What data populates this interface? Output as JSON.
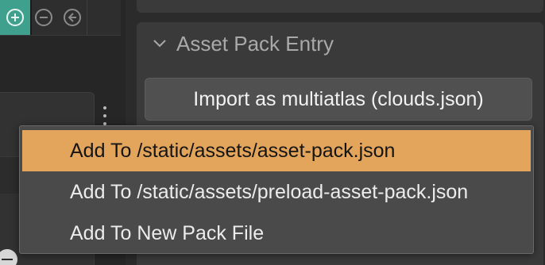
{
  "toolbar": {
    "zoom_in_icon": "zoom-in-icon",
    "zoom_out_icon": "zoom-out-icon",
    "zoom_reset_icon": "zoom-reset-icon",
    "active_color": "#3fa08d"
  },
  "inspector": {
    "section_title": "Asset Pack Entry",
    "import_button_label": "Import as multiatlas (clouds.json)"
  },
  "context_menu": {
    "highlight_color": "#e3a45c",
    "items": [
      {
        "label": "Add To /static/assets/asset-pack.json",
        "highlighted": true
      },
      {
        "label": "Add To /static/assets/preload-asset-pack.json",
        "highlighted": false
      },
      {
        "label": "Add To New Pack File",
        "highlighted": false
      }
    ]
  }
}
